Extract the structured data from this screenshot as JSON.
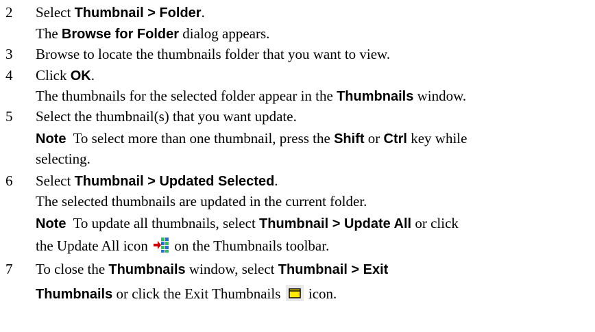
{
  "steps": {
    "s2": {
      "num": "2",
      "pre": "Select ",
      "bold": "Thumbnail > Folder",
      "post": ".",
      "sub": {
        "pre": "The ",
        "bold": "Browse for Folder",
        "post": " dialog appears."
      }
    },
    "s3": {
      "num": "3",
      "text": "Browse to locate the thumbnails folder that you want to view."
    },
    "s4": {
      "num": "4",
      "pre": "Click ",
      "bold": "OK",
      "post": ".",
      "sub": {
        "pre": "The thumbnails for the selected folder appear in the ",
        "bold": "Thumbnails",
        "post": " window."
      }
    },
    "s5": {
      "num": "5",
      "text": "Select the thumbnail(s) that you want update.",
      "note": {
        "label": "Note",
        "pre": "  To select more than one thumbnail, press the ",
        "bold1": "Shift",
        "mid": " or ",
        "bold2": "Ctrl",
        "post": " key while",
        "cont": "selecting."
      }
    },
    "s6": {
      "num": "6",
      "pre": "Select ",
      "bold": "Thumbnail > Updated Selected",
      "post": ".",
      "sub": "The selected thumbnails are updated in the current folder.",
      "note": {
        "label": "Note",
        "pre": "  To update all thumbnails, select ",
        "bold": "Thumbnail > Update All",
        "post": " or click",
        "cont_pre": "the Update All icon ",
        "cont_post": " on the Thumbnails toolbar."
      }
    },
    "s7": {
      "num": "7",
      "pre": "To close the ",
      "bold1": "Thumbnails",
      "mid": " window, select ",
      "bold2": "Thumbnail > Exit",
      "cont_bold": "Thumbnails",
      "cont_mid": " or click the Exit Thumbnails ",
      "cont_post": " icon."
    }
  },
  "icons": {
    "update_all": "update-all-icon",
    "exit_thumbnails": "folder-exit-icon",
    "colors": {
      "update_red": "#cc0000",
      "update_blue": "#1f6fe0",
      "update_green": "#22c55e",
      "exit_bg": "#e8e8e8",
      "exit_folder": "#ffe800"
    }
  }
}
